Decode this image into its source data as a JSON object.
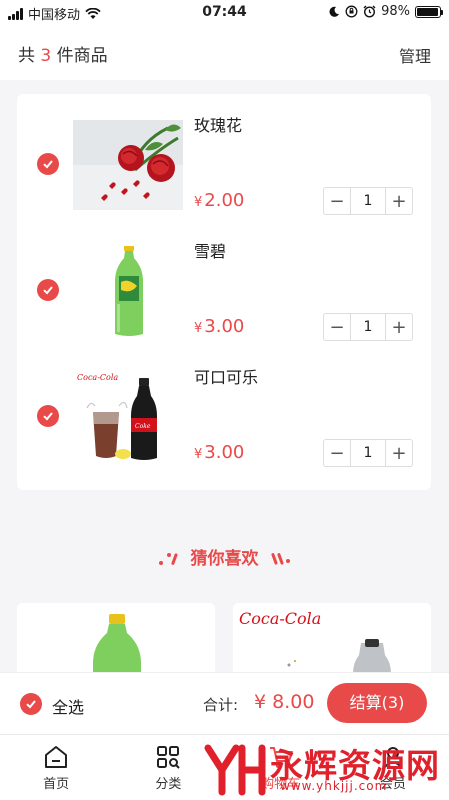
{
  "status_bar": {
    "carrier": "中国移动",
    "time": "07:44",
    "battery": "98%"
  },
  "header": {
    "count_prefix": "共",
    "count_num": "3",
    "count_suffix": "件商品",
    "manage": "管理"
  },
  "cart": {
    "items": [
      {
        "name": "玫瑰花",
        "currency": "¥",
        "price": "2.00",
        "qty": "1"
      },
      {
        "name": "雪碧",
        "currency": "¥",
        "price": "3.00",
        "qty": "1"
      },
      {
        "name": "可口可乐",
        "currency": "¥",
        "price": "3.00",
        "qty": "1"
      }
    ],
    "minus": "−",
    "plus": "+"
  },
  "recommend": {
    "title": "猜你喜欢",
    "coke_logo": "Coca-Cola"
  },
  "checkout": {
    "select_all": "全选",
    "total_label": "合计:",
    "total_value": "¥ 8.00",
    "settle": "结算(3)"
  },
  "tabbar": {
    "tabs": [
      {
        "label": "首页",
        "icon": "home-icon"
      },
      {
        "label": "分类",
        "icon": "category-icon"
      },
      {
        "label": "购物车",
        "icon": "cart-icon"
      },
      {
        "label": "会员",
        "icon": "member-icon"
      }
    ]
  },
  "watermark": {
    "text": "永辉资源网",
    "url": "www.yhkjjj.com"
  },
  "colors": {
    "accent": "#e84a4a",
    "background": "#f5f5f7"
  }
}
